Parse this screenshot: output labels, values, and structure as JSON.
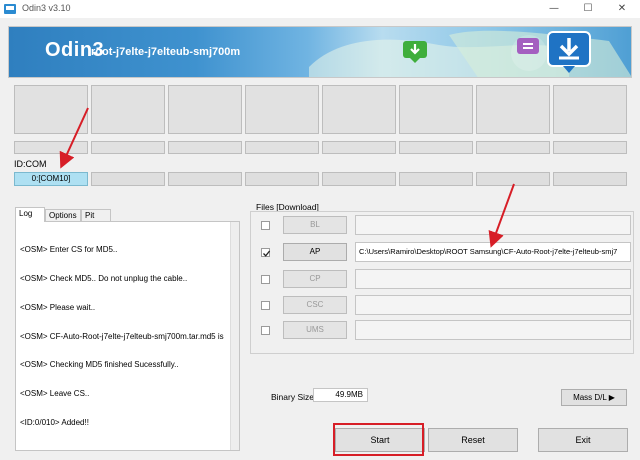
{
  "window": {
    "title": "Odin3 v3.10",
    "minimize_glyph": "—",
    "maximize_glyph": "☐",
    "close_glyph": "✕"
  },
  "banner": {
    "logo": "Odin3",
    "device_text": "root-j7elte-j7elteub-smj700m"
  },
  "id_com": {
    "label": "ID:COM",
    "active_port": "0:[COM10]"
  },
  "tabs": [
    "Log",
    "Options",
    "Pit"
  ],
  "log_lines": [
    "<OSM> Enter CS for MD5..",
    "<OSM> Check MD5.. Do not unplug the cable..",
    "<OSM> Please wait..",
    "<OSM> CF-Auto-Root-j7elte-j7elteub-smj700m.tar.md5 is",
    "<OSM> Checking MD5 finished Sucessfully..",
    "<OSM> Leave CS..",
    "<ID:0/010> Added!!"
  ],
  "files": {
    "label": "Files [Download]",
    "rows": [
      {
        "name": "BL",
        "checked": false,
        "enabled": false,
        "path": ""
      },
      {
        "name": "AP",
        "checked": true,
        "enabled": true,
        "path": "C:\\Users\\Ramiro\\Desktop\\ROOT Samsung\\CF-Auto-Root-j7elte-j7elteub-smj7"
      },
      {
        "name": "CP",
        "checked": false,
        "enabled": false,
        "path": ""
      },
      {
        "name": "CSC",
        "checked": false,
        "enabled": false,
        "path": ""
      },
      {
        "name": "UMS",
        "checked": false,
        "enabled": false,
        "path": ""
      }
    ]
  },
  "binary_size": {
    "label": "Binary Size",
    "value": "49.9MB"
  },
  "buttons": {
    "mass_dl": "Mass D/L ▶",
    "start": "Start",
    "reset": "Reset",
    "exit": "Exit"
  },
  "colors": {
    "highlight": "#d71e27",
    "com_active": "#aee0f2"
  }
}
